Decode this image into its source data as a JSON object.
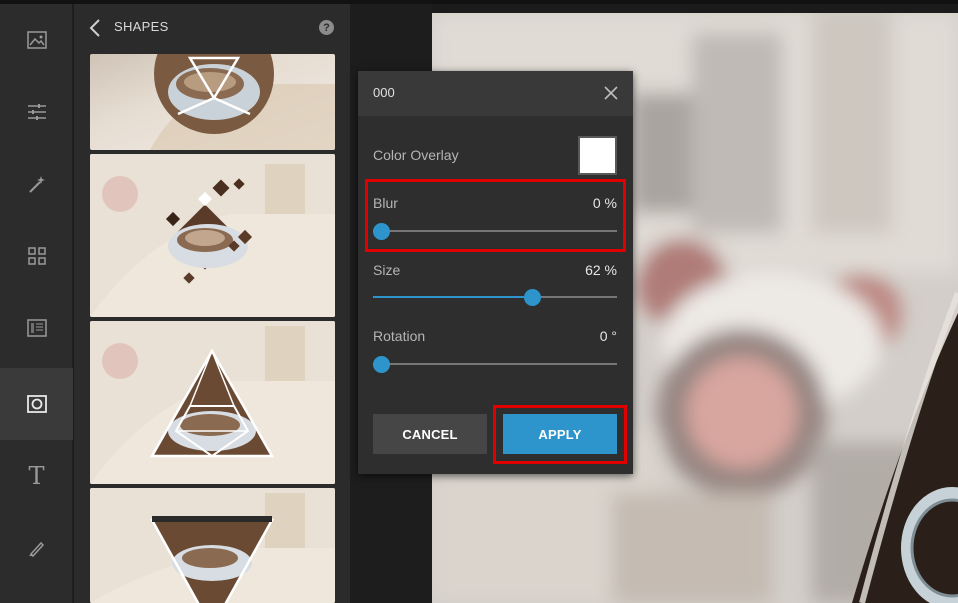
{
  "panel": {
    "title": "SHAPES",
    "help": "?"
  },
  "rail": {
    "items": [
      {
        "icon": "image-icon"
      },
      {
        "icon": "adjust-sliders-icon"
      },
      {
        "icon": "magic-wand-icon"
      },
      {
        "icon": "grid-icon"
      },
      {
        "icon": "texture-icon"
      },
      {
        "icon": "frame-shape-icon",
        "active": true
      },
      {
        "icon": "text-icon"
      },
      {
        "icon": "brush-icon"
      }
    ],
    "text_glyph": "T"
  },
  "dialog": {
    "title": "000",
    "color_overlay_label": "Color Overlay",
    "color_overlay_value": "#ffffff",
    "blur": {
      "label": "Blur",
      "value_text": "0 %",
      "value": 0
    },
    "size": {
      "label": "Size",
      "value_text": "62 %",
      "value": 62
    },
    "rotation": {
      "label": "Rotation",
      "value_text": "0 °",
      "value": 0
    },
    "cancel_label": "CANCEL",
    "apply_label": "APPLY"
  },
  "colors": {
    "accent": "#2d95cc",
    "highlight": "#e00000"
  }
}
